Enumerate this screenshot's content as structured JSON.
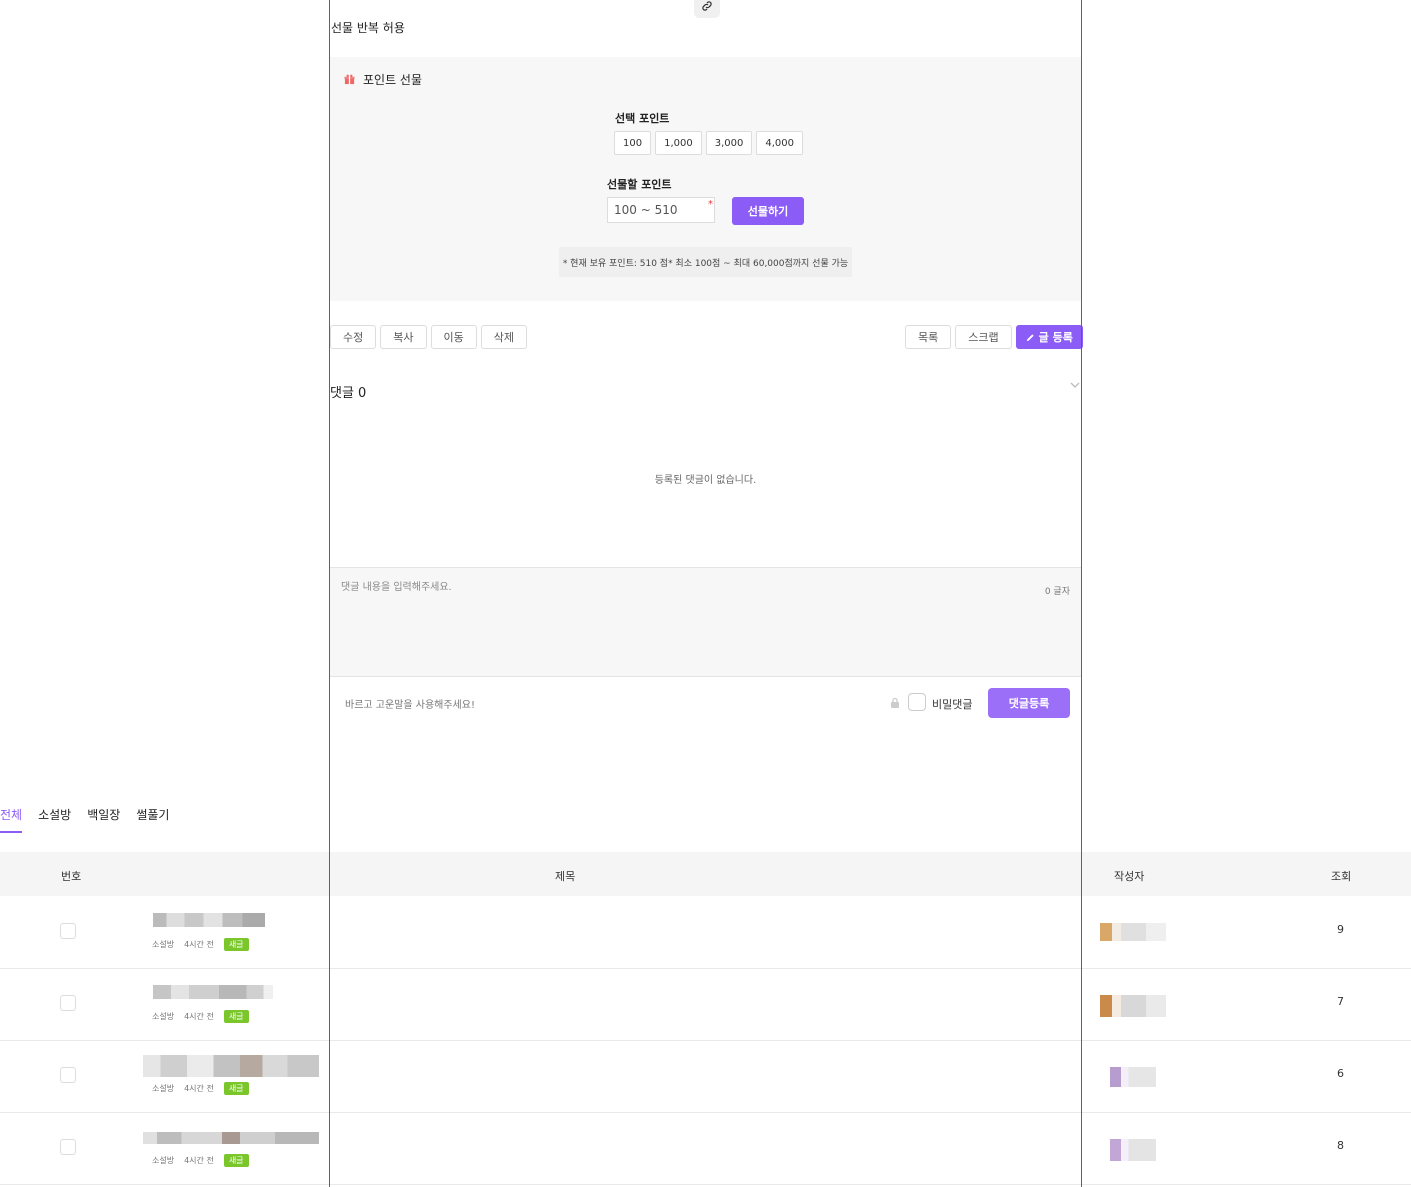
{
  "post": {
    "allow_repeat_label": "선물 반복 허용"
  },
  "gift": {
    "title": "포인트 선물",
    "select_label": "선택 포인트",
    "options": [
      "100",
      "1,000",
      "3,000",
      "4,000"
    ],
    "amount_label": "선물할 포인트",
    "amount_placeholder": "100 ~ 510",
    "required_mark": "*",
    "submit_label": "선물하기",
    "note": "* 현재 보유 포인트: 510 점* 최소 100점 ~ 최대 60,000점까지 선물 가능"
  },
  "actions": {
    "left": [
      "수정",
      "복사",
      "이동",
      "삭제"
    ],
    "list_label": "목록",
    "scrap_label": "스크랩",
    "write_label": "글 등록"
  },
  "comments": {
    "title": "댓글 0",
    "empty": "등록된 댓글이 없습니다.",
    "placeholder": "댓글 내용을 입력해주세요.",
    "char_count": "0 글자",
    "hint": "바르고 고운말을 사용해주세요!",
    "secret_label": "비밀댓글",
    "submit_label": "댓글등록"
  },
  "tabs": [
    "전체",
    "소설방",
    "백일장",
    "썰풀기"
  ],
  "table": {
    "headers": {
      "no": "번호",
      "title": "제목",
      "author": "작성자",
      "views": "조회"
    },
    "rows": [
      {
        "category": "소설방",
        "time": "4시간 전",
        "badge": "새글",
        "views": "9"
      },
      {
        "category": "소설방",
        "time": "4시간 전",
        "badge": "새글",
        "views": "7"
      },
      {
        "category": "소설방",
        "time": "4시간 전",
        "badge": "새글",
        "views": "6"
      },
      {
        "category": "소설방",
        "time": "4시간 전",
        "badge": "새글",
        "views": "8"
      }
    ]
  },
  "colors": {
    "accent": "#8b5cf6",
    "badge": "#7bc72b",
    "divider": "#5b4fd8"
  }
}
